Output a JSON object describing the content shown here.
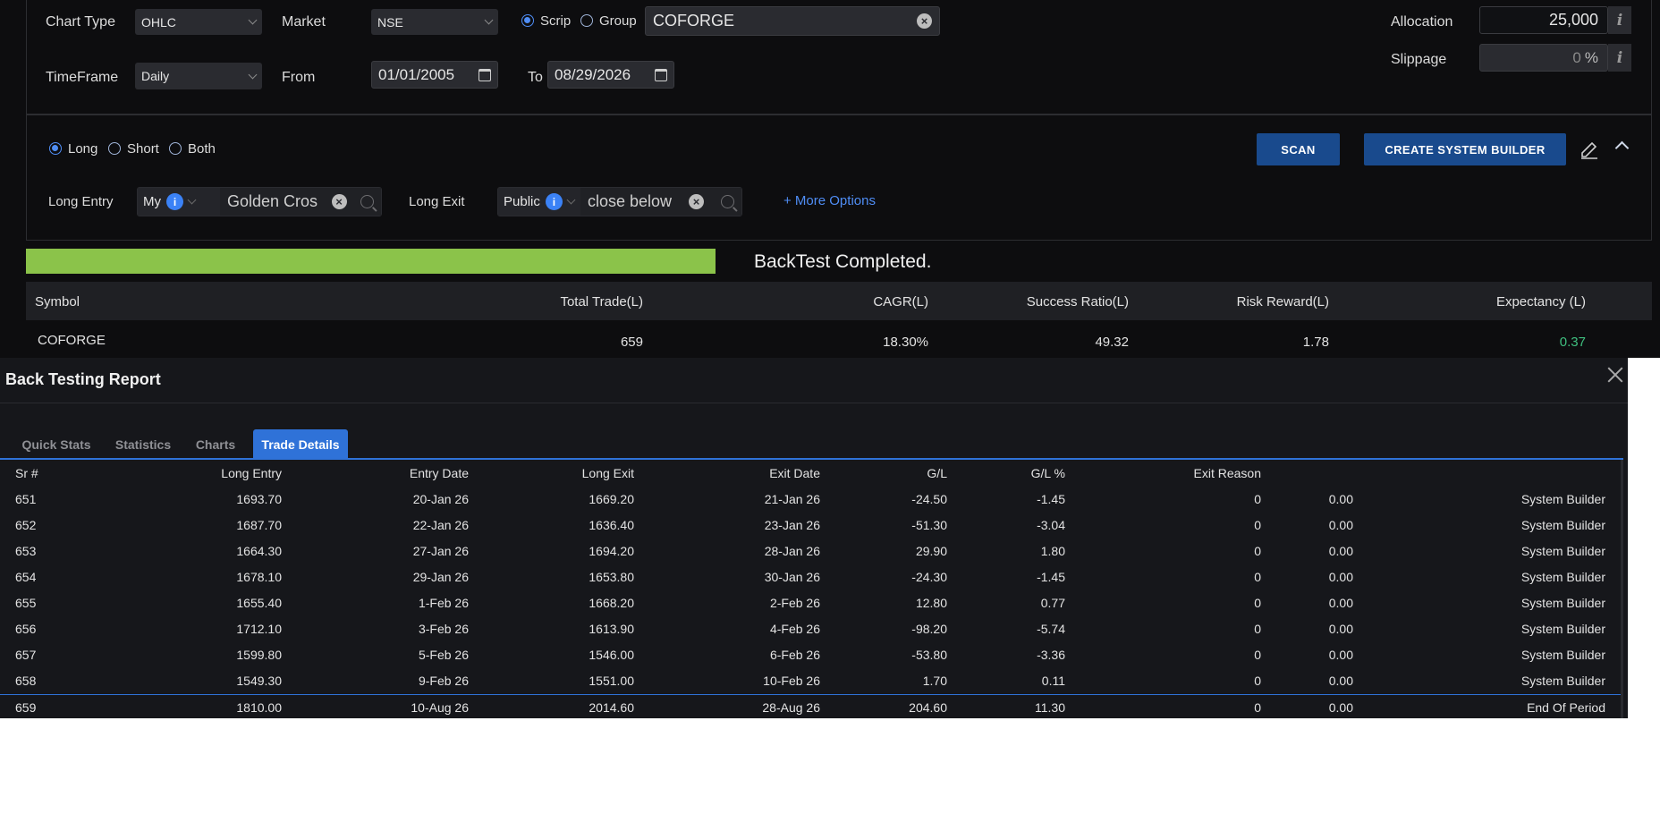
{
  "top": {
    "chart_type_label": "Chart Type",
    "chart_type_value": "OHLC",
    "market_label": "Market",
    "market_value": "NSE",
    "scrip_label": "Scrip",
    "group_label": "Group",
    "symbol_value": "COFORGE",
    "timeframe_label": "TimeFrame",
    "timeframe_value": "Daily",
    "from_label": "From",
    "from_value": "01/01/2005",
    "to_label": "To",
    "to_value": "08/29/2026",
    "allocation_label": "Allocation",
    "allocation_value": "25,000",
    "slippage_label": "Slippage",
    "slippage_value": "0",
    "slippage_unit": "%",
    "info_glyph": "i"
  },
  "strategy": {
    "long_label": "Long",
    "short_label": "Short",
    "both_label": "Both",
    "scan_label": "SCAN",
    "create_label": "CREATE SYSTEM BUILDER",
    "long_entry_label": "Long Entry",
    "long_entry_source": "My",
    "long_entry_value": "Golden Cros",
    "long_exit_label": "Long Exit",
    "long_exit_source": "Public",
    "long_exit_value": "close below",
    "more_options": "+ More Options",
    "info_glyph": "i"
  },
  "progress": {
    "fraction": 1.0,
    "status_text": "BackTest Completed.",
    "bar_color": "#8bc34a"
  },
  "results": {
    "headers": [
      "Symbol",
      "Total Trade(L)",
      "CAGR(L)",
      "Success Ratio(L)",
      "Risk Reward(L)",
      "Expectancy (L)"
    ],
    "row": [
      "COFORGE",
      "659",
      "18.30%",
      "49.32",
      "1.78",
      "0.37"
    ],
    "expectancy_color": "#3fbf7f"
  },
  "report": {
    "title": "Back Testing Report",
    "tabs": [
      "Quick Stats",
      "Statistics",
      "Charts",
      "Trade Details"
    ],
    "active_tab": "Trade Details",
    "headers": [
      "Sr #",
      "Long Entry",
      "Entry Date",
      "Long Exit",
      "Exit Date",
      "G/L",
      "G/L %",
      "Exit Reason"
    ],
    "rows": [
      [
        "651",
        "1693.70",
        "20-Jan 26",
        "1669.20",
        "21-Jan 26",
        "-24.50",
        "-1.45",
        "0",
        "0.00",
        "System Builder"
      ],
      [
        "652",
        "1687.70",
        "22-Jan 26",
        "1636.40",
        "23-Jan 26",
        "-51.30",
        "-3.04",
        "0",
        "0.00",
        "System Builder"
      ],
      [
        "653",
        "1664.30",
        "27-Jan 26",
        "1694.20",
        "28-Jan 26",
        "29.90",
        "1.80",
        "0",
        "0.00",
        "System Builder"
      ],
      [
        "654",
        "1678.10",
        "29-Jan 26",
        "1653.80",
        "30-Jan 26",
        "-24.30",
        "-1.45",
        "0",
        "0.00",
        "System Builder"
      ],
      [
        "655",
        "1655.40",
        "1-Feb 26",
        "1668.20",
        "2-Feb 26",
        "12.80",
        "0.77",
        "0",
        "0.00",
        "System Builder"
      ],
      [
        "656",
        "1712.10",
        "3-Feb 26",
        "1613.90",
        "4-Feb 26",
        "-98.20",
        "-5.74",
        "0",
        "0.00",
        "System Builder"
      ],
      [
        "657",
        "1599.80",
        "5-Feb 26",
        "1546.00",
        "6-Feb 26",
        "-53.80",
        "-3.36",
        "0",
        "0.00",
        "System Builder"
      ],
      [
        "658",
        "1549.30",
        "9-Feb 26",
        "1551.00",
        "10-Feb 26",
        "1.70",
        "0.11",
        "0",
        "0.00",
        "System Builder"
      ],
      [
        "659",
        "1810.00",
        "10-Aug 26",
        "2014.60",
        "28-Aug 26",
        "204.60",
        "11.30",
        "0",
        "0.00",
        "End Of Period"
      ]
    ]
  }
}
